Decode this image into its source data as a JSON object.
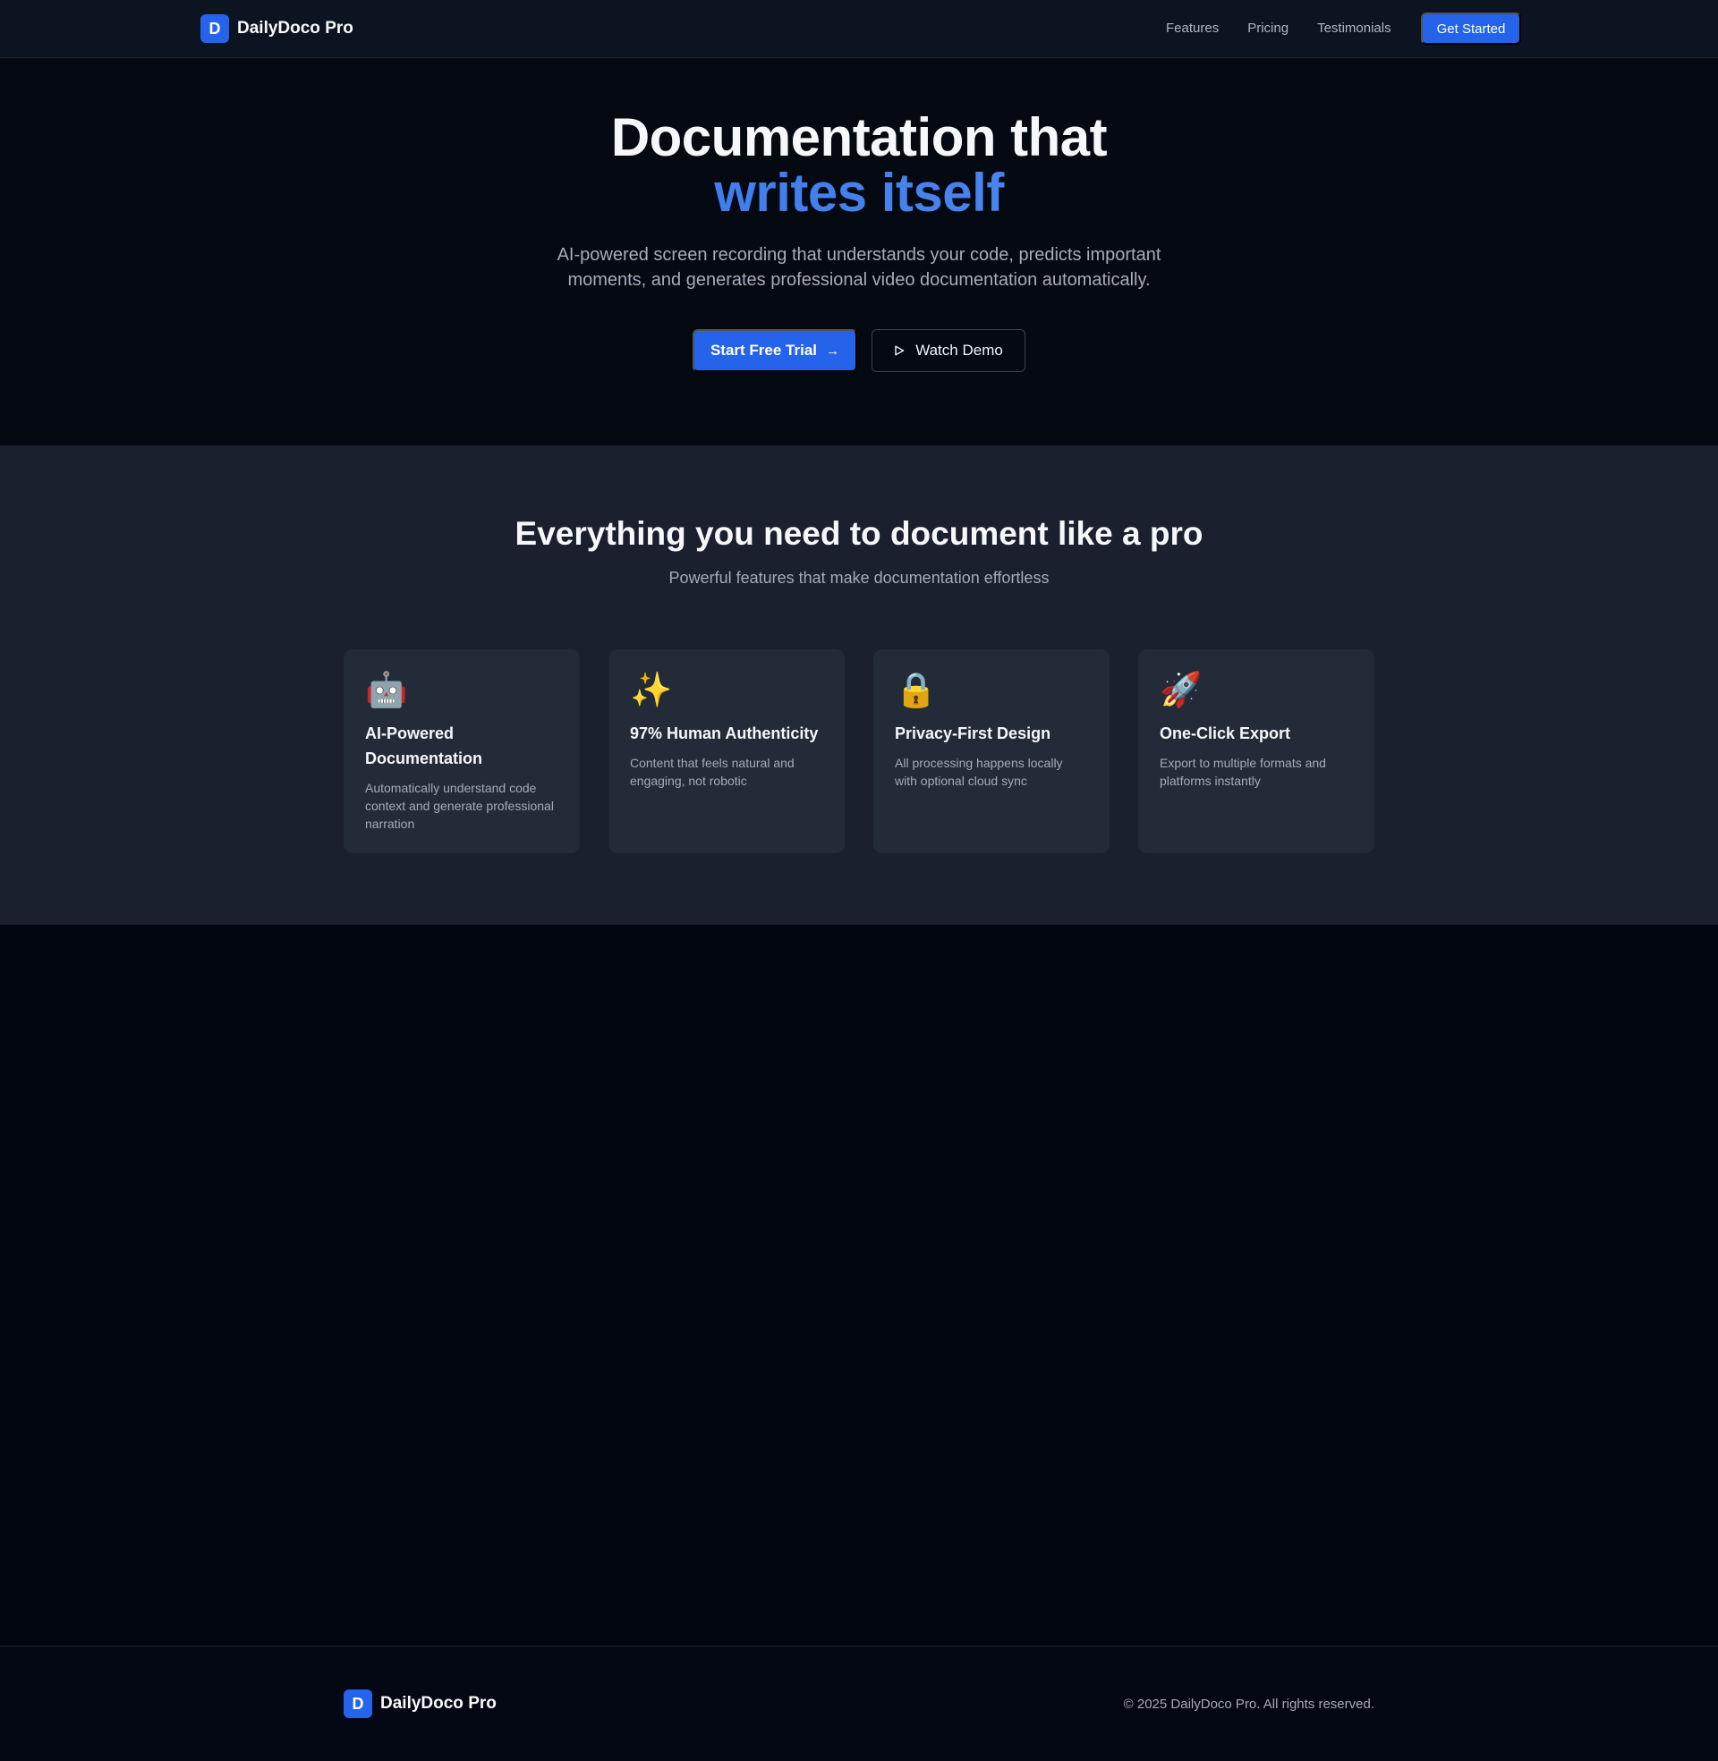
{
  "nav": {
    "logo_letter": "D",
    "brand": "DailyDoco Pro",
    "links": [
      "Features",
      "Pricing",
      "Testimonials"
    ],
    "cta": "Get Started"
  },
  "hero": {
    "title_line1": "Documentation that",
    "title_line2": "writes itself",
    "subtitle": "AI-powered screen recording that understands your code, predicts important moments, and generates professional video documentation automatically.",
    "primary_button": "Start Free Trial",
    "primary_icon": "→",
    "secondary_button": "Watch Demo"
  },
  "features": {
    "title": "Everything you need to document like a pro",
    "subtitle": "Powerful features that make documentation effortless",
    "cards": [
      {
        "icon": "🤖",
        "icon_name": "robot-icon",
        "title": "AI-Powered Documentation",
        "description": "Automatically understand code context and generate professional narration"
      },
      {
        "icon": "✨",
        "icon_name": "sparkles-icon",
        "title": "97% Human Authenticity",
        "description": "Content that feels natural and engaging, not robotic"
      },
      {
        "icon": "🔒",
        "icon_name": "lock-icon",
        "title": "Privacy-First Design",
        "description": "All processing happens locally with optional cloud sync"
      },
      {
        "icon": "🚀",
        "icon_name": "rocket-icon",
        "title": "One-Click Export",
        "description": "Export to multiple formats and platforms instantly"
      }
    ]
  },
  "footer": {
    "logo_letter": "D",
    "brand": "DailyDoco Pro",
    "copyright": "© 2025 DailyDoco Pro. All rights reserved."
  },
  "colors": {
    "accent": "#2563eb",
    "page_bg": "#020610",
    "card_bg": "#232b38"
  }
}
